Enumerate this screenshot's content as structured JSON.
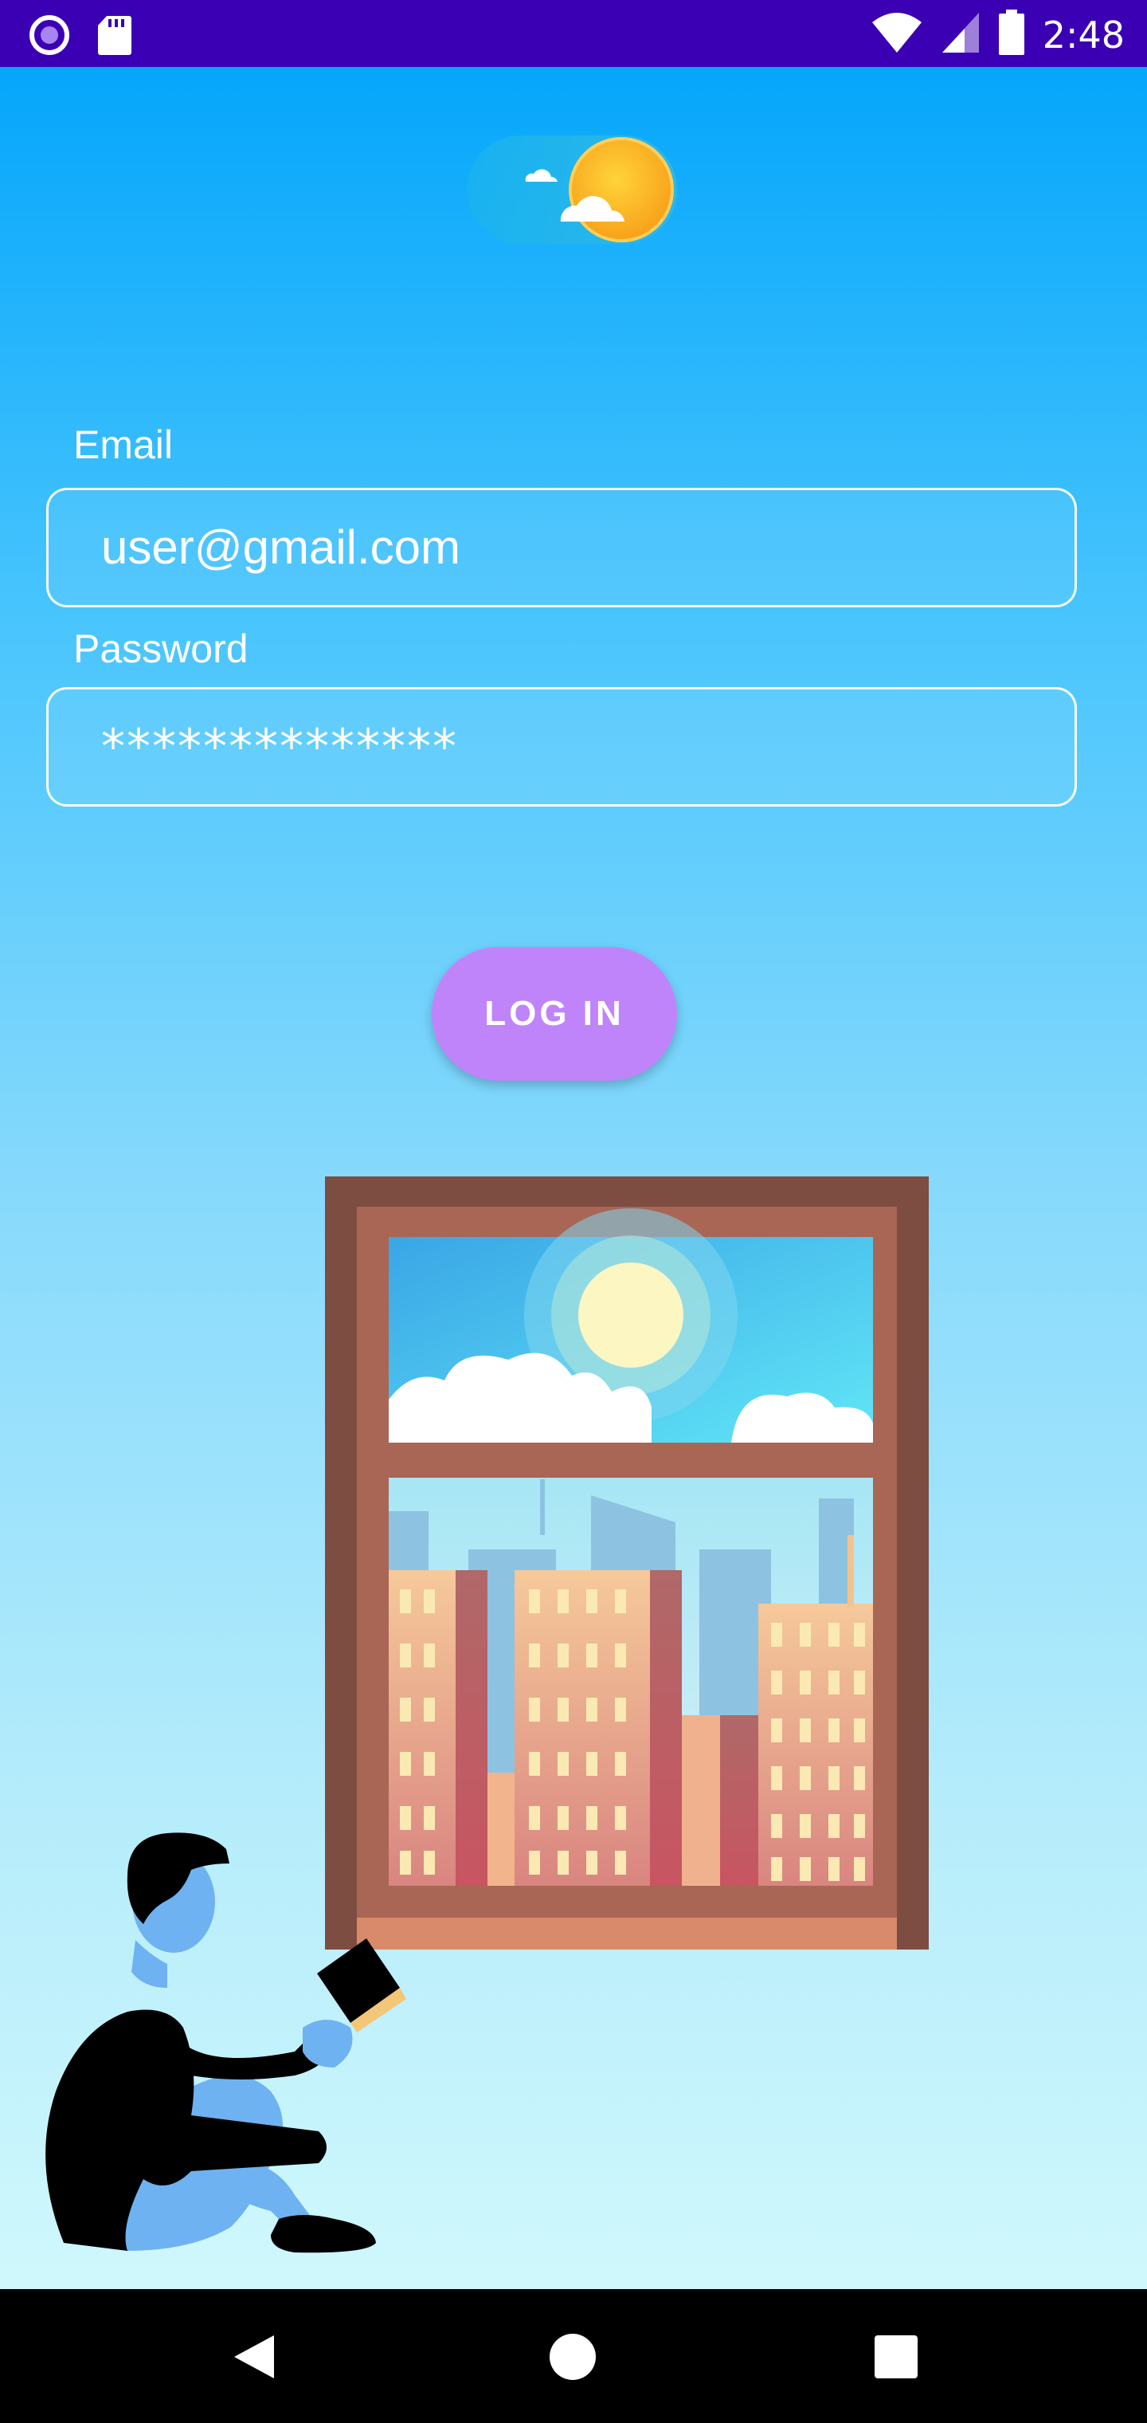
{
  "status_bar": {
    "time": "2:48",
    "left_icons": [
      "notification-circle-icon",
      "sd-card-icon"
    ],
    "right_icons": [
      "wifi-icon",
      "cellular-signal-icon",
      "battery-icon"
    ]
  },
  "logo": {
    "icon": "weather-sun-cloud-icon"
  },
  "form": {
    "email_label": "Email",
    "email_value": "user@gmail.com",
    "password_label": "Password",
    "password_value": "**************"
  },
  "login_button": {
    "label": "LOG IN"
  },
  "illustration": {
    "window": "city-window-illustration",
    "person": "reading-person-illustration"
  },
  "nav_bar": {
    "icons": [
      "back-icon",
      "home-icon",
      "recents-icon"
    ]
  },
  "colors": {
    "status_bar": "#3b00b4",
    "accent_button": "#c084fa",
    "background_top": "#05a6fb",
    "background_bottom": "#cff8fc"
  }
}
